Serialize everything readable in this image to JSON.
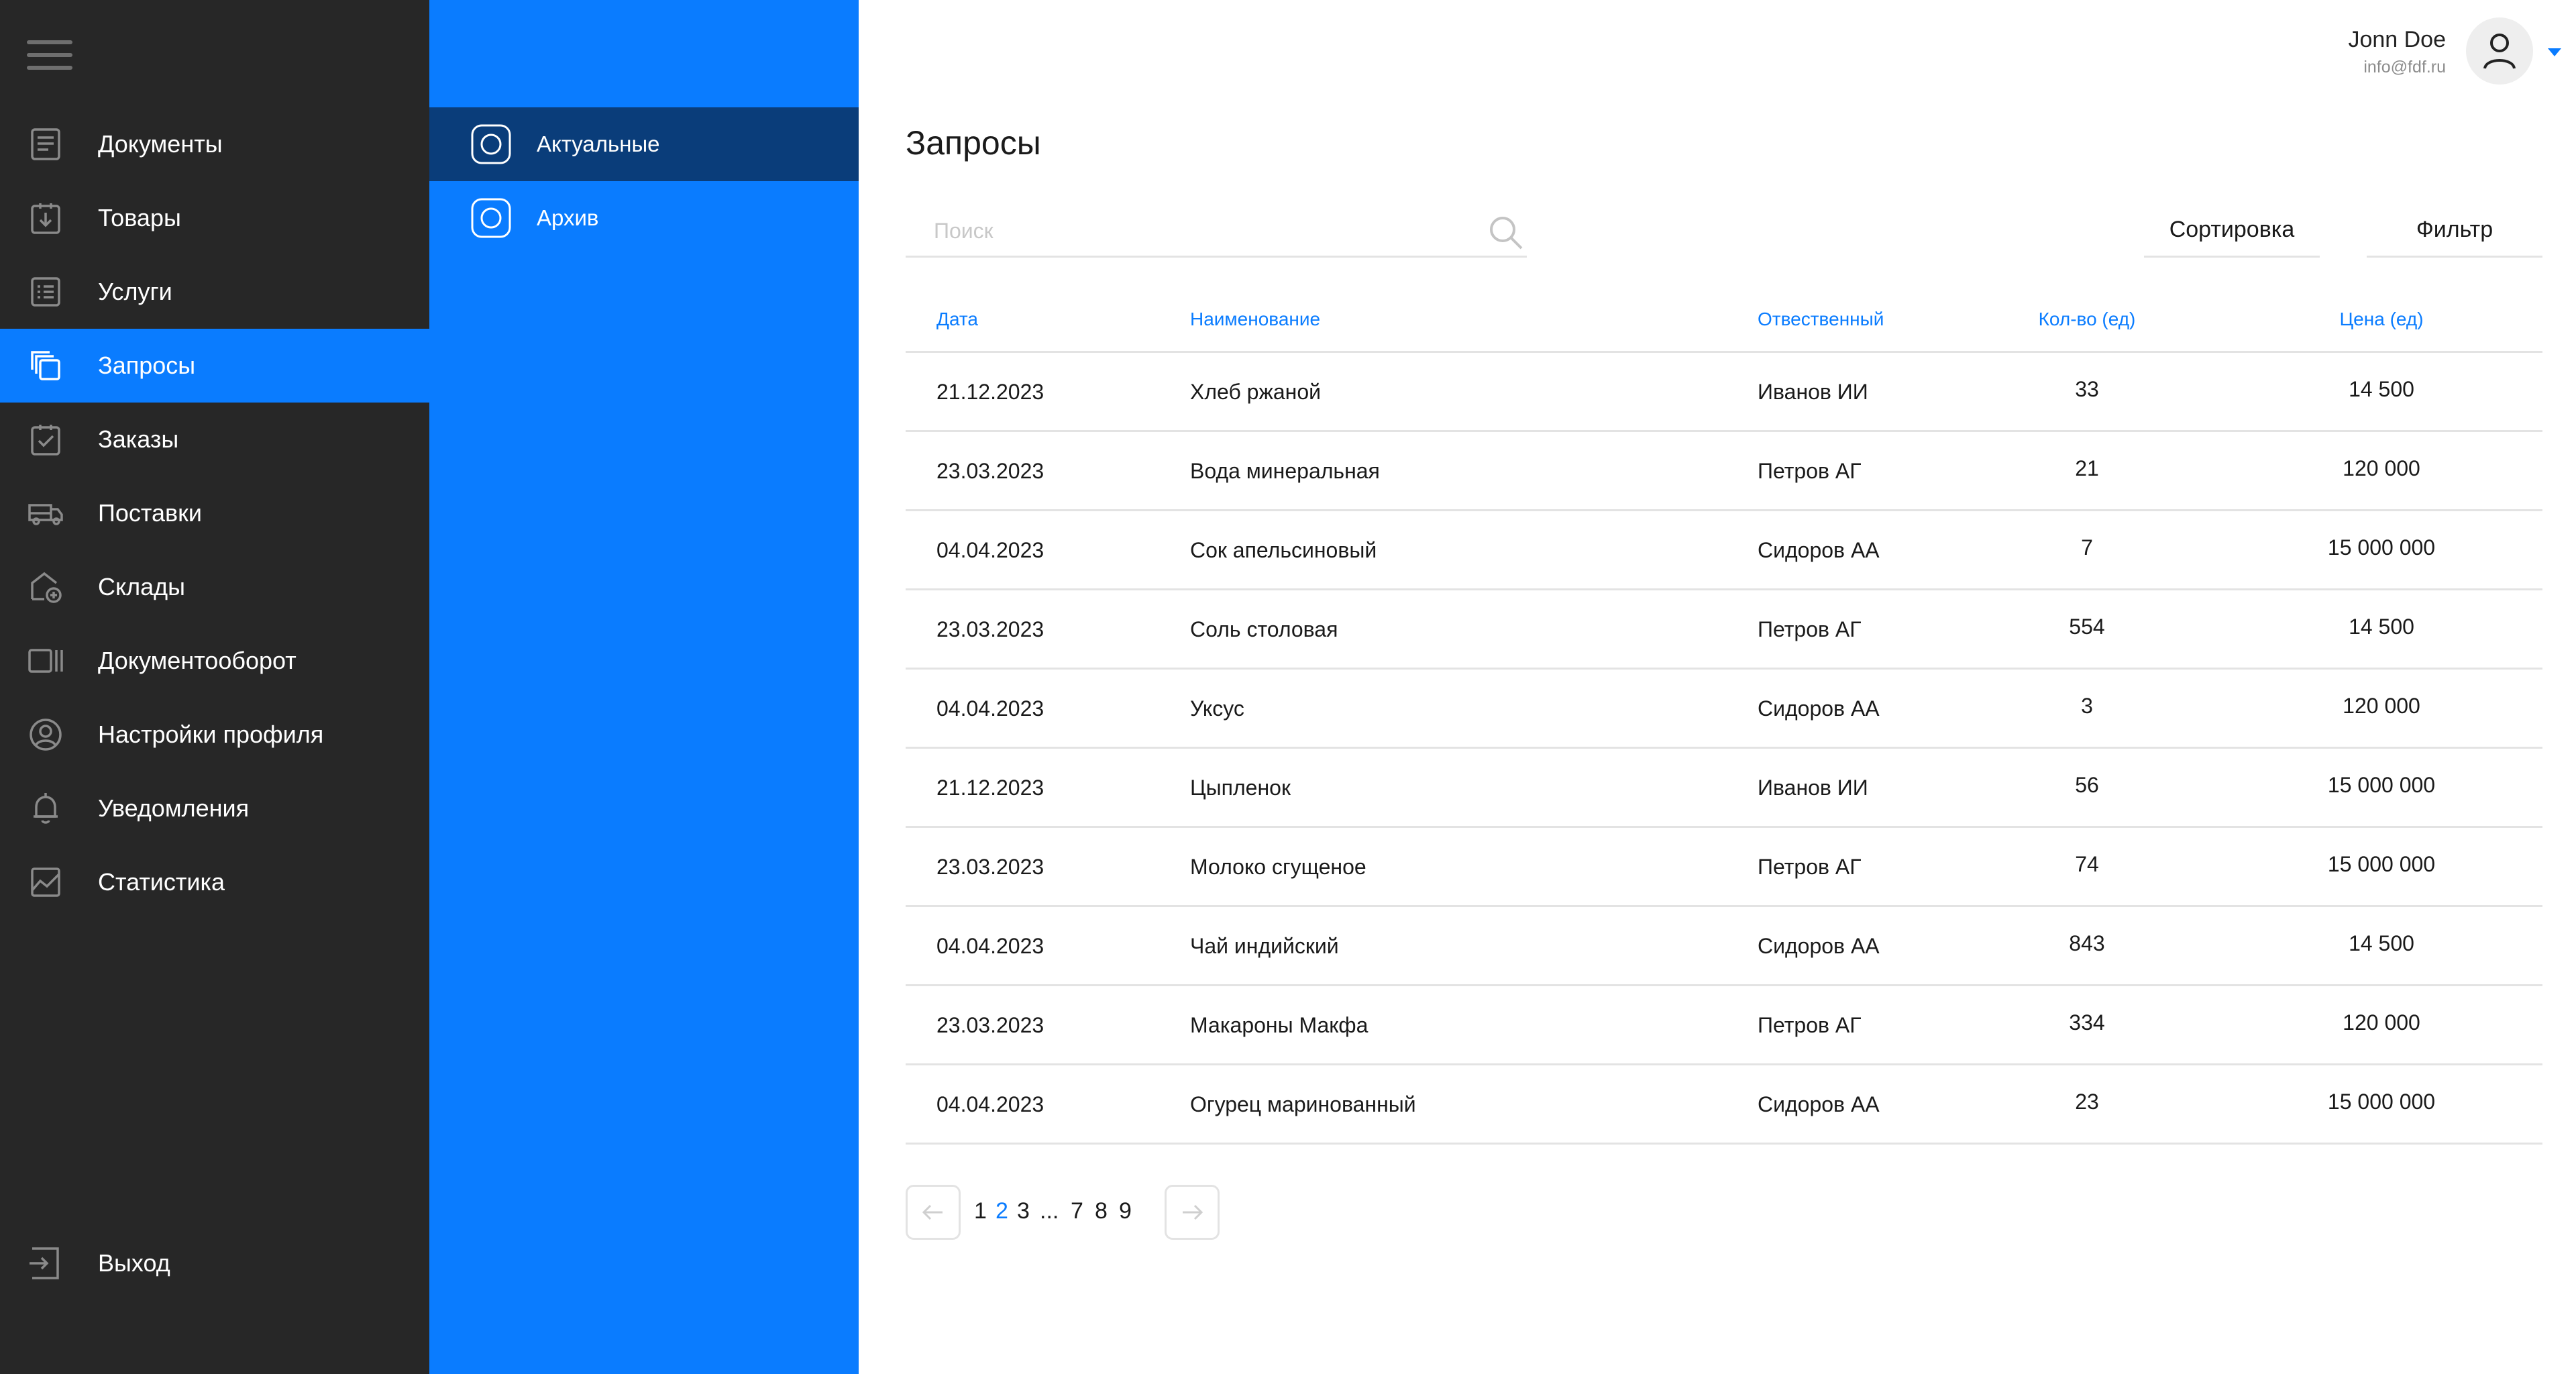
{
  "colors": {
    "sidebar_bg": "#272727",
    "accent": "#0a7cff",
    "subpanel_active": "#0a3d7a",
    "divider": "#e3e3e3"
  },
  "sidebar": {
    "items": [
      {
        "label": "Документы",
        "icon": "document-icon"
      },
      {
        "label": "Товары",
        "icon": "goods-box-icon"
      },
      {
        "label": "Услуги",
        "icon": "services-list-icon"
      },
      {
        "label": "Запросы",
        "icon": "requests-copy-icon",
        "active": true
      },
      {
        "label": "Заказы",
        "icon": "orders-clipboard-icon"
      },
      {
        "label": "Поставки",
        "icon": "delivery-truck-icon"
      },
      {
        "label": "Склады",
        "icon": "warehouse-icon"
      },
      {
        "label": "Документооборот",
        "icon": "document-flow-icon"
      },
      {
        "label": "Настройки профиля",
        "icon": "profile-settings-icon"
      },
      {
        "label": "Уведомления",
        "icon": "bell-icon"
      },
      {
        "label": "Статистика",
        "icon": "chart-icon"
      }
    ],
    "logout_label": "Выход"
  },
  "subnav": {
    "items": [
      {
        "label": "Актуальные",
        "active": true
      },
      {
        "label": "Архив"
      }
    ]
  },
  "user": {
    "name": "Jonn Doe",
    "email": "info@fdf.ru"
  },
  "page": {
    "title": "Запросы"
  },
  "search": {
    "placeholder": "Поиск"
  },
  "toolbar": {
    "sort_label": "Сортировка",
    "filter_label": "Фильтр"
  },
  "table": {
    "columns": {
      "date": "Дата",
      "name": "Наименование",
      "responsible": "Отвественный",
      "qty": "Кол-во (ед)",
      "price": "Цена (ед)"
    },
    "rows": [
      {
        "date": "21.12.2023",
        "name": "Хлеб ржаной",
        "responsible": "Иванов ИИ",
        "qty": "33",
        "price": "14 500"
      },
      {
        "date": "23.03.2023",
        "name": "Вода минеральная",
        "responsible": "Петров АГ",
        "qty": "21",
        "price": "120 000"
      },
      {
        "date": "04.04.2023",
        "name": "Сок апельсиновый",
        "responsible": "Сидоров АА",
        "qty": "7",
        "price": "15 000 000"
      },
      {
        "date": "23.03.2023",
        "name": "Соль столовая",
        "responsible": "Петров АГ",
        "qty": "554",
        "price": "14 500"
      },
      {
        "date": "04.04.2023",
        "name": "Уксус",
        "responsible": "Сидоров АА",
        "qty": "3",
        "price": "120 000"
      },
      {
        "date": "21.12.2023",
        "name": "Цыпленок",
        "responsible": "Иванов ИИ",
        "qty": "56",
        "price": "15 000 000"
      },
      {
        "date": "23.03.2023",
        "name": "Молоко сгущеное",
        "responsible": "Петров АГ",
        "qty": "74",
        "price": "15 000 000"
      },
      {
        "date": "04.04.2023",
        "name": "Чай индийский",
        "responsible": "Сидоров АА",
        "qty": "843",
        "price": "14 500"
      },
      {
        "date": "23.03.2023",
        "name": "Макароны Макфа",
        "responsible": "Петров АГ",
        "qty": "334",
        "price": "120 000"
      },
      {
        "date": "04.04.2023",
        "name": "Огурец маринованный",
        "responsible": "Сидоров АА",
        "qty": "23",
        "price": "15 000 000"
      }
    ]
  },
  "pagination": {
    "pages": [
      "1",
      "2",
      "3",
      "7",
      "8",
      "9"
    ],
    "current": "2",
    "ellipsis": "..."
  }
}
